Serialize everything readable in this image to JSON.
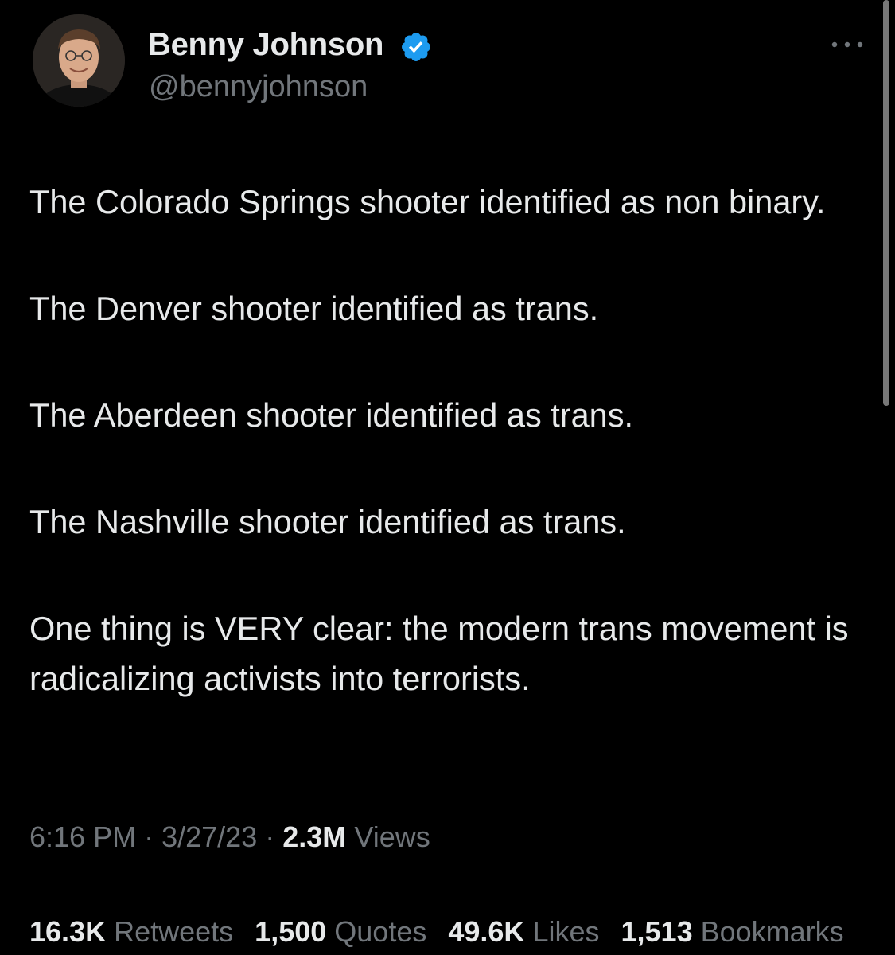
{
  "author": {
    "name": "Benny Johnson",
    "handle": "@bennyjohnson",
    "verified": true
  },
  "tweet": {
    "paragraphs": [
      "The Colorado Springs shooter identified as non binary.",
      "The Denver shooter identified as trans.",
      "The Aberdeen shooter identified as trans.",
      "The Nashville shooter identified as trans.",
      "One thing is VERY clear: the modern trans movement is radicalizing activists into terrorists."
    ]
  },
  "meta": {
    "time": "6:16 PM",
    "separator": "·",
    "date": "3/27/23",
    "views_count": "2.3M",
    "views_label": "Views"
  },
  "stats": [
    {
      "count": "16.3K",
      "label": "Retweets"
    },
    {
      "count": "1,500",
      "label": "Quotes"
    },
    {
      "count": "49.6K",
      "label": "Likes"
    },
    {
      "count": "1,513",
      "label": "Bookmarks"
    }
  ],
  "icons": {
    "verified": "verified-badge-icon",
    "more": "more-horizontal-icon"
  },
  "colors": {
    "background": "#000000",
    "primary_text": "#e7e9ea",
    "secondary_text": "#71767b",
    "verified_blue": "#1d9bf0",
    "divider": "#2f3336"
  }
}
